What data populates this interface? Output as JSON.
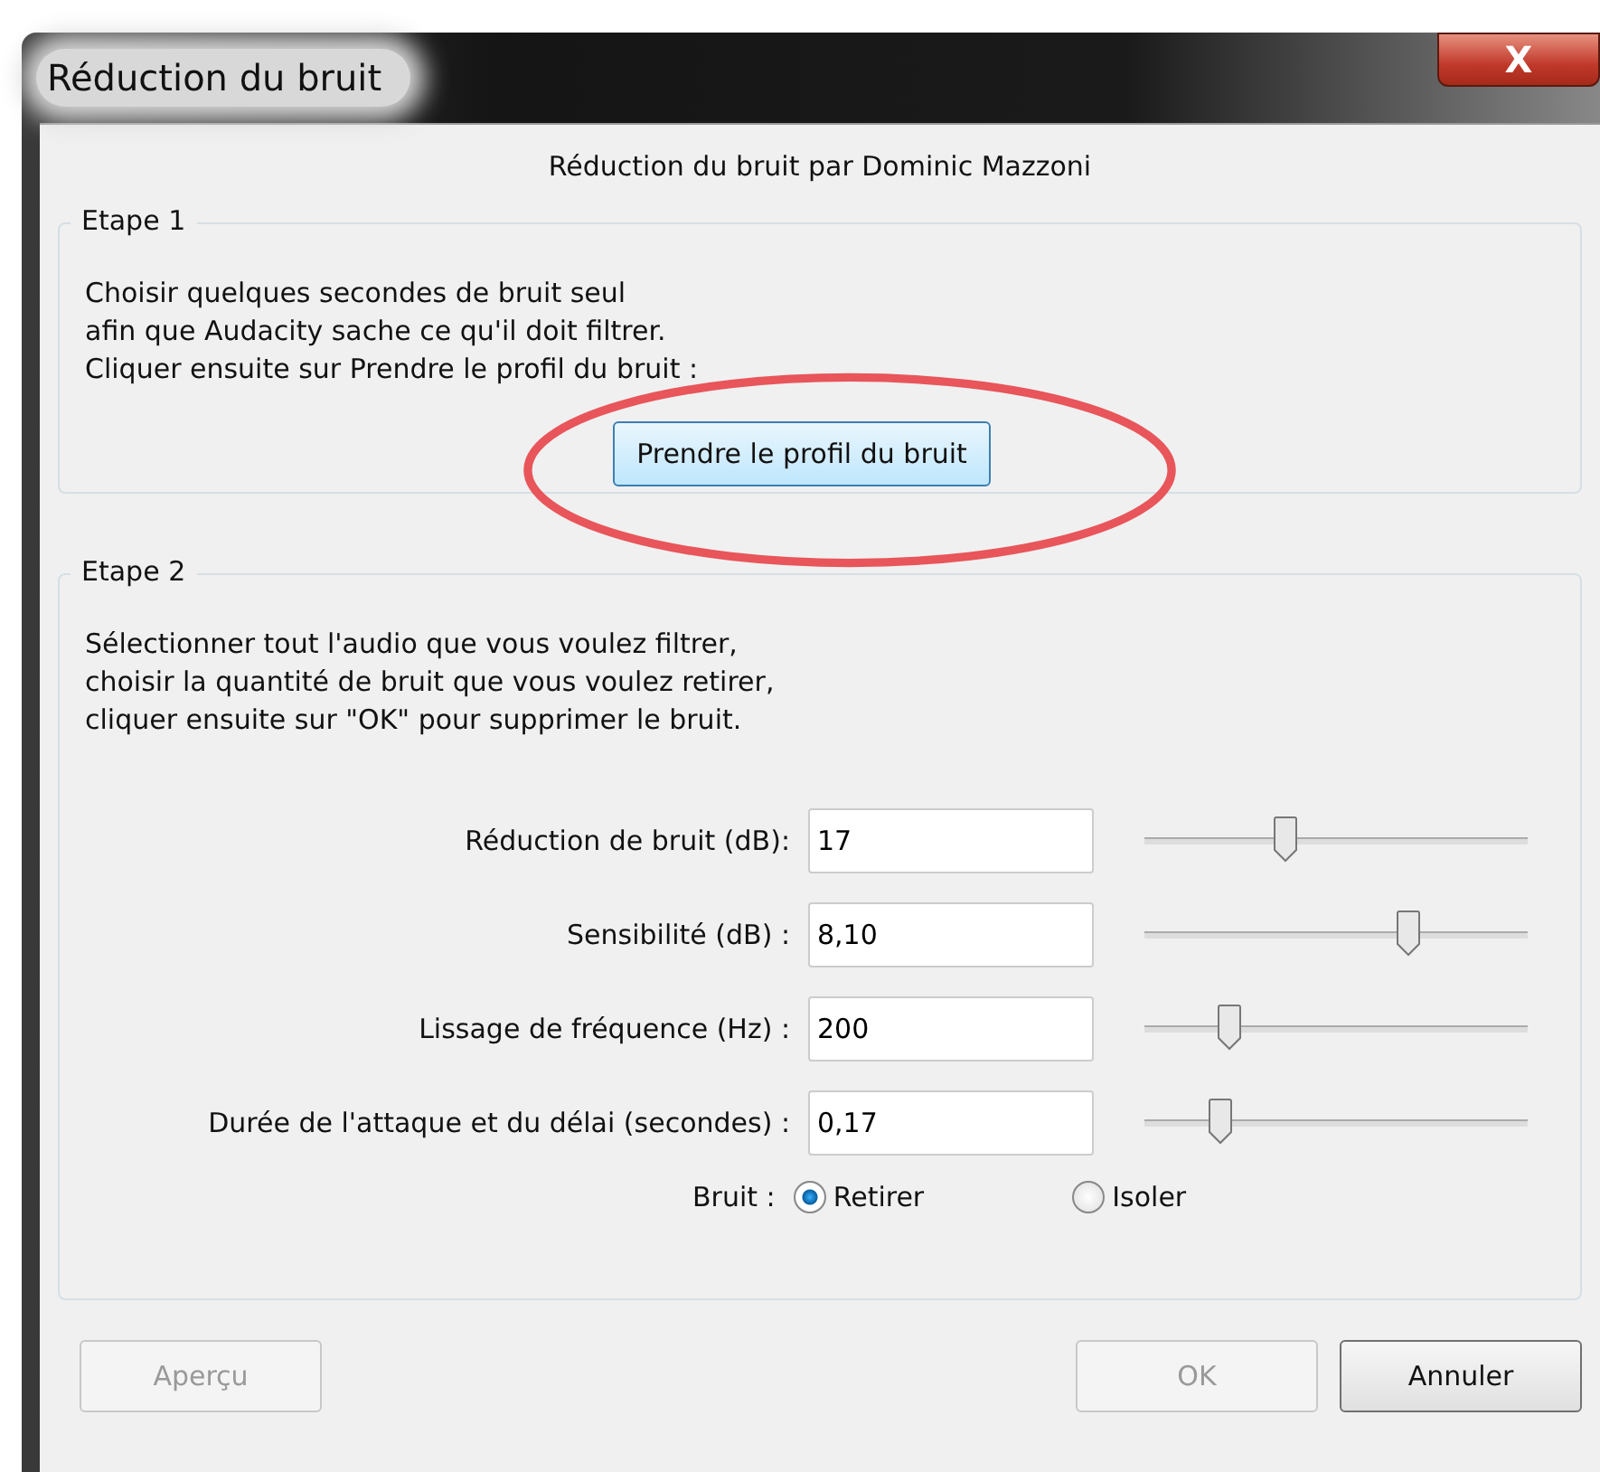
{
  "window": {
    "title": "Réduction du bruit",
    "close": "X"
  },
  "header": "Réduction du bruit par Dominic Mazzoni",
  "step1": {
    "title": "Etape 1",
    "lines": [
      "Choisir quelques secondes de bruit seul",
      "afin que Audacity sache ce qu'il doit filtrer.",
      "Cliquer ensuite sur Prendre le profil du bruit :"
    ],
    "button": "Prendre le profil du bruit",
    "highlighted": true
  },
  "step2": {
    "title": "Etape 2",
    "lines": [
      "Sélectionner tout l'audio que vous voulez filtrer,",
      "choisir la quantité de bruit que vous voulez retirer,",
      "cliquer ensuite sur \"OK\" pour supprimer le bruit."
    ],
    "settings": [
      {
        "label": "Réduction de bruit (dB):",
        "value": "17",
        "level": 0.37
      },
      {
        "label": "Sensibilité (dB) :",
        "value": "8,10",
        "level": 0.69
      },
      {
        "label": "Lissage de fréquence (Hz) :",
        "value": "200",
        "level": 0.22
      },
      {
        "label": "Durée de l'attaque et du délai (secondes) :",
        "value": "0,17",
        "level": 0.2
      }
    ],
    "noise": {
      "label": "Bruit :",
      "options": [
        {
          "label": "Retirer",
          "selected": true
        },
        {
          "label": "Isoler",
          "selected": false
        }
      ]
    }
  },
  "buttons": [
    {
      "label": "Aperçu",
      "disabled": true
    },
    {
      "label": "OK",
      "disabled": true
    },
    {
      "label": "Annuler",
      "disabled": false
    }
  ]
}
